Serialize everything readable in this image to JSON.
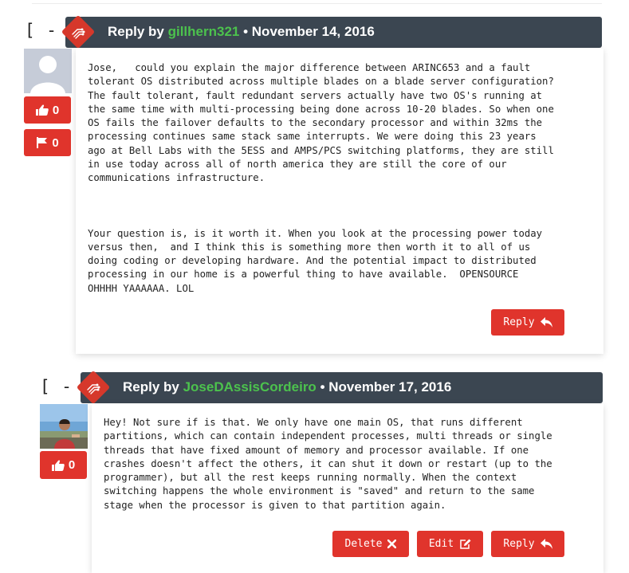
{
  "comments": [
    {
      "toggle": "[ - ]",
      "reply_by": "Reply by",
      "author": "gillhern321",
      "dot": "•",
      "date": "November 14, 2016",
      "likes": "0",
      "dislikes": "0",
      "avatar_icon": "default-user-avatar",
      "body": "Jose,   could you explain the major difference between ARINC653 and a fault\ntolerant OS distributed across multiple blades on a blade server configuration?\nThe fault tolerant, fault redundant servers actually have two OS's running at\nthe same time with multi-processing being done across 10-20 blades. So when one\nOS fails the failover defaults to the secondary processor and within 32ms the\nprocessing continues same stack same interrupts. We were doing this 23 years\nago at Bell Labs with the 5ESS and AMPS/PCS switching platforms, they are still\nin use today across all of north america they are still the core of our\ncommunications infrastructure.\n\n\n\nYour question is, is it worth it. When you look at the processing power today\nversus then,  and I think this is something more then worth it to all of us\ndoing coding or developing hardware. And the potential impact to distributed\nprocessing in our home is a powerful thing to have available.  OPENSOURCE\nOHHHH YAAAAAA. LOL",
      "actions": {
        "reply": "Reply"
      }
    },
    {
      "toggle": "[ - ]",
      "reply_by": "Reply by",
      "author": "JoseDAssisCordeiro",
      "dot": "•",
      "date": "November 17, 2016",
      "likes": "0",
      "avatar_icon": "user-photo-avatar",
      "body": "Hey! Not sure if is that. We only have one main OS, that runs different\npartitions, which can contain independent processes, multi threads or single\nthreads that have fixed amount of memory and processor available. If one\ncrashes doesn't affect the others, it can shut it down or restart (up to the\nprogrammer), but all the rest keeps running normally. When the context\nswitching happens the whole environment is \"saved\" and return to the same\nstage when the processor is given to that partition again.",
      "actions": {
        "delete": "Delete",
        "edit": "Edit",
        "reply": "Reply"
      }
    }
  ],
  "colors": {
    "header_bg": "#3b4651",
    "accent_red": "#e0342c",
    "author_green": "#4cc24d",
    "badge_red": "#d6382b"
  }
}
